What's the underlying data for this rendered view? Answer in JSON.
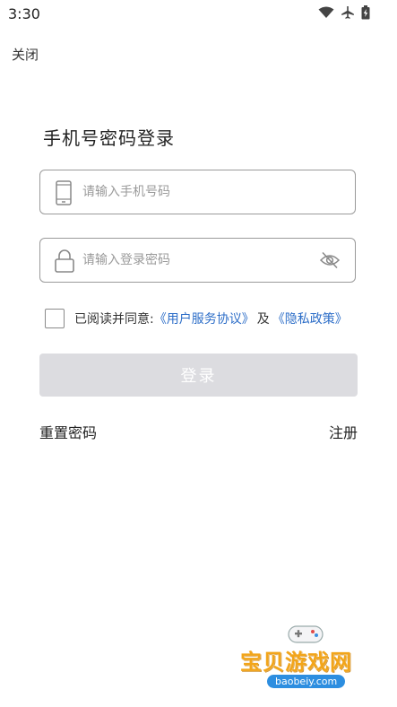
{
  "status_bar": {
    "time": "3:30"
  },
  "header": {
    "close_label": "关闭"
  },
  "page": {
    "title": "手机号密码登录"
  },
  "phone": {
    "placeholder": "请输入手机号码",
    "value": ""
  },
  "password": {
    "placeholder": "请输入登录密码",
    "value": ""
  },
  "agreement": {
    "prefix": "已阅读并同意:",
    "terms_link": "《用户服务协议》",
    "conjunction": "及",
    "privacy_link": "《隐私政策》",
    "checked": false
  },
  "login_button": {
    "label": "登录"
  },
  "footer_links": {
    "reset_password": "重置密码",
    "register": "注册"
  },
  "watermark": {
    "text": "宝贝游戏网",
    "url": "baobeiy.com"
  },
  "colors": {
    "link": "#2d6ec8",
    "button_disabled": "#dcdce0",
    "border": "#9a9a9a"
  }
}
